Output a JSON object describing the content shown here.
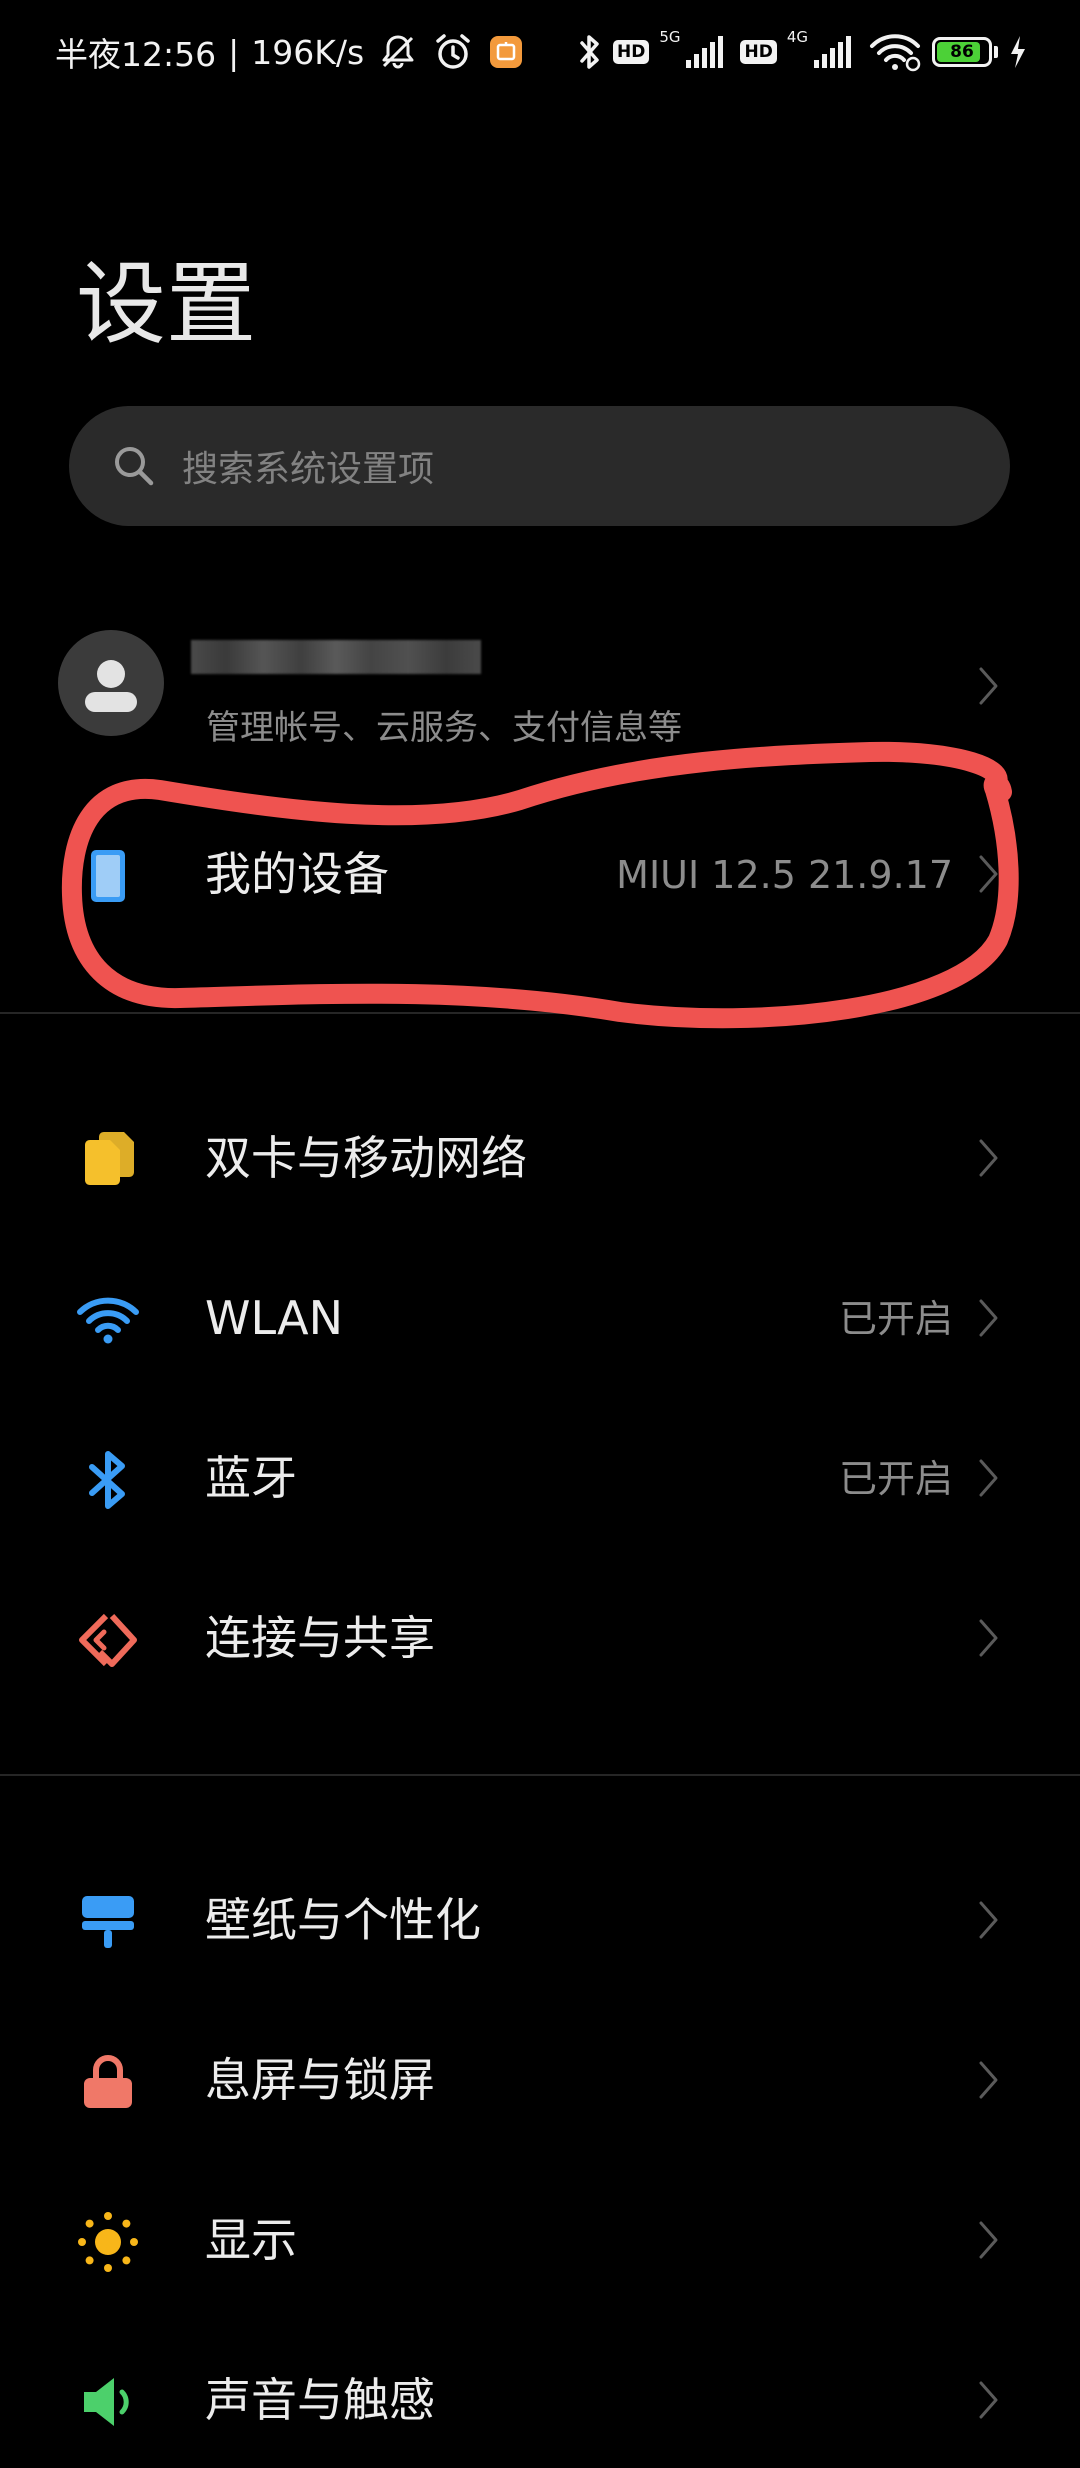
{
  "status_bar": {
    "time": "半夜12:56",
    "separator": "|",
    "net_speed": "196K/s",
    "net_5g": "5G",
    "net_4g": "4G",
    "hd": "HD",
    "battery_percent": "86",
    "battery_level": 0.86
  },
  "page": {
    "title": "设置"
  },
  "search": {
    "placeholder": "搜索系统设置项"
  },
  "account": {
    "subtitle": "管理帐号、云服务、支付信息等"
  },
  "sections": [
    {
      "items": [
        {
          "label": "我的设备",
          "value": "MIUI 12.5 21.9.17"
        }
      ]
    },
    {
      "items": [
        {
          "label": "双卡与移动网络",
          "value": ""
        },
        {
          "label": "WLAN",
          "value": "已开启"
        },
        {
          "label": "蓝牙",
          "value": "已开启"
        },
        {
          "label": "连接与共享",
          "value": ""
        }
      ]
    },
    {
      "items": [
        {
          "label": "壁纸与个性化",
          "value": ""
        },
        {
          "label": "息屏与锁屏",
          "value": ""
        },
        {
          "label": "显示",
          "value": ""
        },
        {
          "label": "声音与触感",
          "value": ""
        }
      ]
    }
  ],
  "icons": {
    "my_device": "phone-icon",
    "sim": "sim-card-icon",
    "wlan": "wifi-icon",
    "bluetooth": "bluetooth-icon",
    "share": "connection-share-icon",
    "wallpaper": "wallpaper-brush-icon",
    "lock": "lock-icon",
    "display": "sun-icon",
    "sound": "speaker-icon"
  },
  "colors": {
    "background": "#000000",
    "accent_blue": "#3a9cf5",
    "sim_yellow": "#f5c02c",
    "share_red": "#ef6a5a",
    "lock_red": "#f07868",
    "sun_yellow": "#f8b619",
    "sound_green": "#4cd06b",
    "annotation_red": "#ef5350"
  }
}
